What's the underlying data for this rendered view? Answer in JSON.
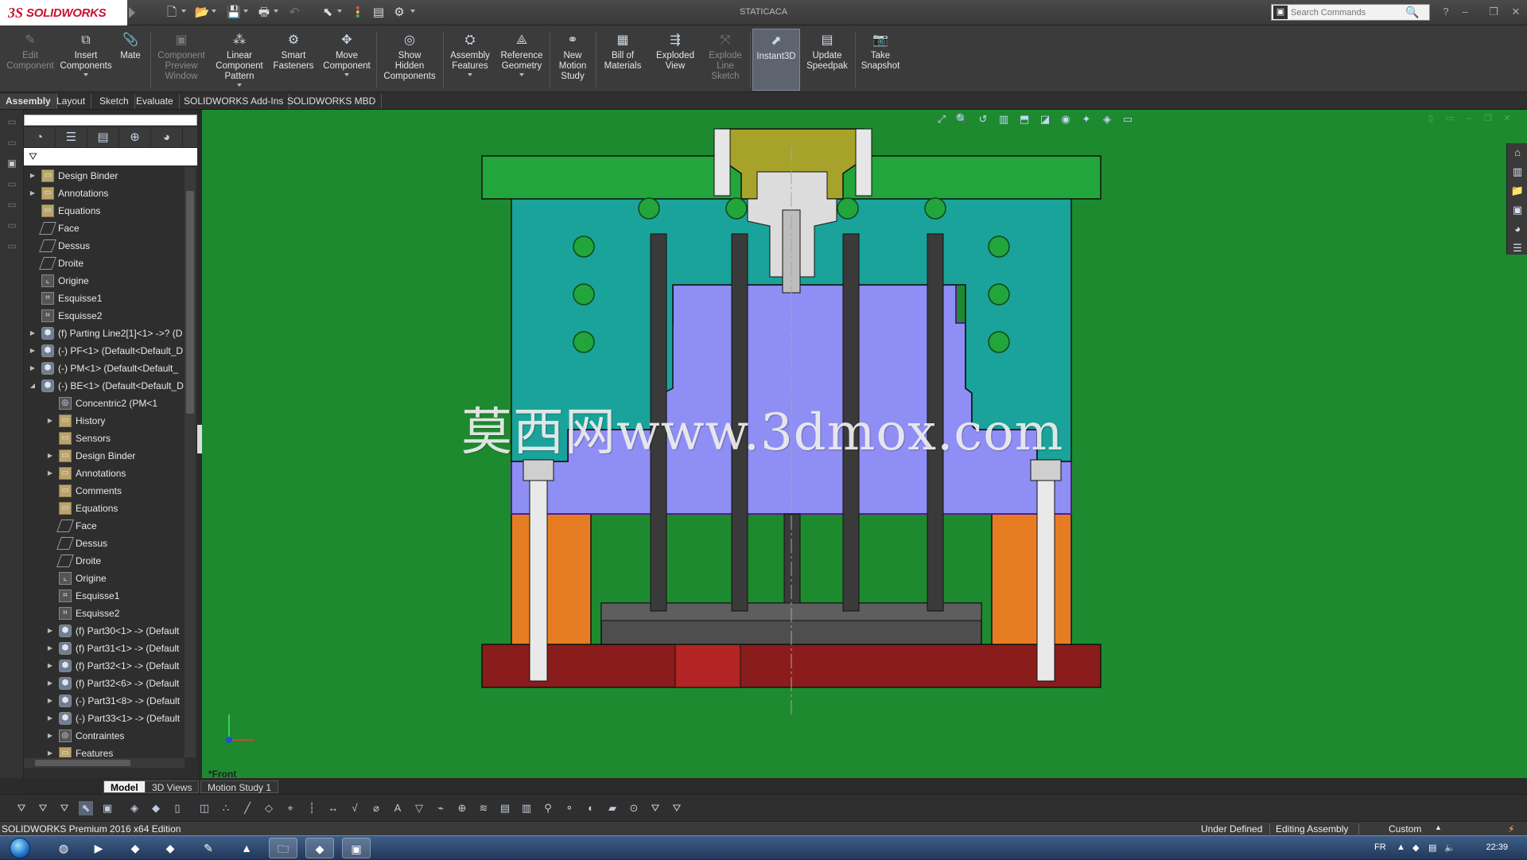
{
  "app": {
    "title": "STATICACA",
    "logo_ds": "3S",
    "logo_text": "SOLIDWORKS"
  },
  "search": {
    "placeholder": "Search Commands"
  },
  "commands": [
    {
      "id": "edit-component",
      "label": "Edit\nComponent",
      "icon": "edit-component-icon",
      "glyph": "✎",
      "disabled": true
    },
    {
      "id": "insert-components",
      "label": "Insert\nComponents",
      "icon": "insert-components-icon",
      "glyph": "⧉",
      "dropdown": true
    },
    {
      "id": "mate",
      "label": "Mate",
      "icon": "mate-icon",
      "glyph": "📎"
    },
    {
      "id": "component-preview-window",
      "label": "Component\nPreview\nWindow",
      "icon": "preview-window-icon",
      "glyph": "▣",
      "disabled": true
    },
    {
      "id": "linear-component-pattern",
      "label": "Linear\nComponent\nPattern",
      "icon": "linear-pattern-icon",
      "glyph": "⁂",
      "dropdown": true
    },
    {
      "id": "smart-fasteners",
      "label": "Smart\nFasteners",
      "icon": "smart-fasteners-icon",
      "glyph": "⚙"
    },
    {
      "id": "move-component",
      "label": "Move\nComponent",
      "icon": "move-component-icon",
      "glyph": "✥",
      "dropdown": true
    },
    {
      "id": "show-hidden-components",
      "label": "Show\nHidden\nComponents",
      "icon": "show-hidden-icon",
      "glyph": "◎"
    },
    {
      "id": "assembly-features",
      "label": "Assembly\nFeatures",
      "icon": "assembly-features-icon",
      "glyph": "⛭",
      "dropdown": true
    },
    {
      "id": "reference-geometry",
      "label": "Reference\nGeometry",
      "icon": "reference-geometry-icon",
      "glyph": "⟁",
      "dropdown": true
    },
    {
      "id": "new-motion-study",
      "label": "New\nMotion\nStudy",
      "icon": "motion-study-icon",
      "glyph": "⚭"
    },
    {
      "id": "bill-of-materials",
      "label": "Bill of\nMaterials",
      "icon": "bom-icon",
      "glyph": "▦"
    },
    {
      "id": "exploded-view",
      "label": "Exploded\nView",
      "icon": "exploded-view-icon",
      "glyph": "⇶"
    },
    {
      "id": "explode-line-sketch",
      "label": "Explode\nLine\nSketch",
      "icon": "explode-line-icon",
      "glyph": "⤧",
      "disabled": true
    },
    {
      "id": "instant3d",
      "label": "Instant3D",
      "icon": "instant3d-icon",
      "glyph": "⬈",
      "active": true
    },
    {
      "id": "update-speedpak",
      "label": "Update\nSpeedpak",
      "icon": "speedpak-icon",
      "glyph": "▤"
    },
    {
      "id": "take-snapshot",
      "label": "Take\nSnapshot",
      "icon": "camera-icon",
      "glyph": "📷"
    }
  ],
  "tabs": [
    "Assembly",
    "Layout",
    "Sketch",
    "Evaluate",
    "SOLIDWORKS Add-Ins",
    "SOLIDWORKS MBD"
  ],
  "tree": [
    {
      "level": 0,
      "expander": "right",
      "icon": "folder",
      "label": "Design Binder"
    },
    {
      "level": 0,
      "expander": "right",
      "icon": "folder",
      "label": "Annotations"
    },
    {
      "level": 0,
      "expander": "",
      "icon": "folder",
      "label": "Equations"
    },
    {
      "level": 0,
      "expander": "",
      "icon": "plane",
      "label": "Face"
    },
    {
      "level": 0,
      "expander": "",
      "icon": "plane",
      "label": "Dessus"
    },
    {
      "level": 0,
      "expander": "",
      "icon": "plane",
      "label": "Droite"
    },
    {
      "level": 0,
      "expander": "",
      "icon": "origin",
      "label": "Origine"
    },
    {
      "level": 0,
      "expander": "",
      "icon": "sketch",
      "label": "Esquisse1"
    },
    {
      "level": 0,
      "expander": "",
      "icon": "sketch",
      "label": "Esquisse2"
    },
    {
      "level": 0,
      "expander": "right",
      "icon": "part",
      "label": "(f) Parting Line2[1]<1> ->? (D"
    },
    {
      "level": 0,
      "expander": "right",
      "icon": "part",
      "label": "(-) PF<1> (Default<Default_D"
    },
    {
      "level": 0,
      "expander": "right",
      "icon": "part",
      "label": "(-) PM<1> (Default<Default_"
    },
    {
      "level": 0,
      "expander": "down",
      "icon": "part",
      "label": "(-) BE<1> (Default<Default_D"
    },
    {
      "level": 1,
      "expander": "",
      "icon": "mate",
      "label": "Concentric2 (PM<1"
    },
    {
      "level": 1,
      "expander": "right",
      "icon": "folder",
      "label": "History"
    },
    {
      "level": 1,
      "expander": "",
      "icon": "folder",
      "label": "Sensors"
    },
    {
      "level": 1,
      "expander": "right",
      "icon": "folder",
      "label": "Design Binder"
    },
    {
      "level": 1,
      "expander": "right",
      "icon": "folder",
      "label": "Annotations"
    },
    {
      "level": 1,
      "expander": "",
      "icon": "folder",
      "label": "Comments"
    },
    {
      "level": 1,
      "expander": "",
      "icon": "folder",
      "label": "Equations"
    },
    {
      "level": 1,
      "expander": "",
      "icon": "plane",
      "label": "Face"
    },
    {
      "level": 1,
      "expander": "",
      "icon": "plane",
      "label": "Dessus"
    },
    {
      "level": 1,
      "expander": "",
      "icon": "plane",
      "label": "Droite"
    },
    {
      "level": 1,
      "expander": "",
      "icon": "origin",
      "label": "Origine"
    },
    {
      "level": 1,
      "expander": "",
      "icon": "sketch",
      "label": "Esquisse1"
    },
    {
      "level": 1,
      "expander": "",
      "icon": "sketch",
      "label": "Esquisse2"
    },
    {
      "level": 1,
      "expander": "right",
      "icon": "part",
      "label": "(f) Part30<1> -> (Default"
    },
    {
      "level": 1,
      "expander": "right",
      "icon": "part",
      "label": "(f) Part31<1> -> (Default"
    },
    {
      "level": 1,
      "expander": "right",
      "icon": "part",
      "label": "(f) Part32<1> -> (Default"
    },
    {
      "level": 1,
      "expander": "right",
      "icon": "part",
      "label": "(f) Part32<6> -> (Default"
    },
    {
      "level": 1,
      "expander": "right",
      "icon": "part",
      "label": "(-) Part31<8> -> (Default"
    },
    {
      "level": 1,
      "expander": "right",
      "icon": "part",
      "label": "(-) Part33<1> -> (Default"
    },
    {
      "level": 1,
      "expander": "right",
      "icon": "mate",
      "label": "Contraintes"
    },
    {
      "level": 1,
      "expander": "right",
      "icon": "folder",
      "label": "Features"
    }
  ],
  "viewport": {
    "view_name": "*Front",
    "watermark": "莫西网www.3dmox.com",
    "background": "#1e8a2f",
    "colors": {
      "top_plate": "#22a53a",
      "cavity_plate": "#1aa39a",
      "core_block": "#8f8ef5",
      "ejector_pins": "#3a3a3a",
      "support_blocks": "#e77d22",
      "bottom_plate": "#8b1c1c",
      "sprue_bushing": "#a7a22a",
      "ejector_plate": "#4e4e4e"
    }
  },
  "model_tabs": [
    "Model",
    "3D Views",
    "Motion Study 1"
  ],
  "status": {
    "edition": "SOLIDWORKS Premium 2016 x64 Edition",
    "definition": "Under Defined",
    "mode": "Editing Assembly",
    "units": "Custom"
  },
  "taskbar": {
    "language": "FR",
    "clock": "22:39"
  }
}
